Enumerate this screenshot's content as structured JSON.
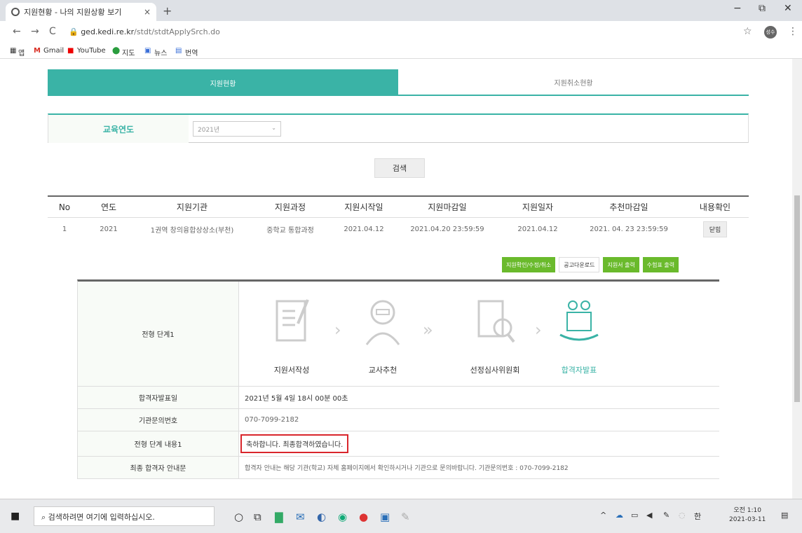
{
  "browser": {
    "tab_title": "지원현황 - 나의 지원상황 보기",
    "tab_close": "×",
    "new_tab": "+",
    "minimize": "−",
    "restore": "⧉",
    "close": "✕",
    "back": "←",
    "forward": "→",
    "reload": "C",
    "url_domain": "ged.kedi.re.kr",
    "url_path": "/stdt/stdtApplySrch.do",
    "star": "☆",
    "menu": "⋮",
    "avatar": "성수"
  },
  "bookmarks": {
    "apps": "앱",
    "gmail": "Gmail",
    "youtube": "YouTube",
    "maps": "지도",
    "news": "뉴스",
    "translate": "번역"
  },
  "tabs": {
    "active": "지원현황",
    "inactive": "지원취소현황"
  },
  "filter": {
    "label": "교육연도",
    "year_value": "2021년",
    "caret": "⌄"
  },
  "search_button": "검색",
  "table": {
    "headers": [
      "No",
      "연도",
      "지원기관",
      "지원과정",
      "지원시작일",
      "지원마감일",
      "지원일자",
      "추천마감일",
      "내용확인"
    ],
    "rows": [
      [
        "1",
        "2021",
        "1권역 창의융합상상소(부천)",
        "중학교 통합과정",
        "2021.04.12",
        "2021.04.20 23:59:59",
        "2021.04.12",
        "2021. 04. 23 23:59:59",
        "닫힘"
      ]
    ]
  },
  "actions": {
    "confirm": "지원확인/수정/취소",
    "notice_download": "공고다운로드",
    "print_application": "지원서 출력",
    "print_exam": "수험표 출력"
  },
  "detail": {
    "stage_label": "전형 단계1",
    "stages": [
      "지원서작성",
      "교사추천",
      "선정심사위원회",
      "합격자발표"
    ],
    "stage_icons": [
      "document-quill-icon",
      "teacher-icon",
      "review-magnifier-icon",
      "people-award-icon"
    ],
    "rows": [
      {
        "label": "합격자발표일",
        "value": "2021년 5월 4일 18시 00분 00초"
      },
      {
        "label": "기관문의번호",
        "value": "070-7099-2182"
      },
      {
        "label": "전형 단계 내용1",
        "value": "축하합니다. 최종합격하였습니다."
      },
      {
        "label": "최종 합격자 안내문",
        "value": "합격자 안내는 해당 기관(학교) 자체 홈페이지에서 확인하시거나 기관으로 문의바랍니다. 기관문의번호 : 070-7099-2182"
      }
    ]
  },
  "taskbar": {
    "search_placeholder": "검색하려면 여기에 입력하십시오.",
    "ime": "한",
    "time": "오전 1:10",
    "date": "2021-03-11"
  },
  "colors": {
    "accent": "#3ab3a6",
    "green_button": "#6aba2c",
    "highlight_border": "#d9262c"
  }
}
